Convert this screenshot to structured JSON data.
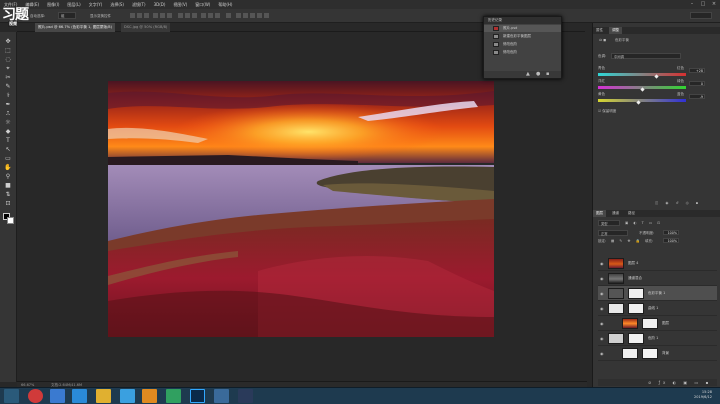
{
  "menubar": {
    "items": [
      "文件(F)",
      "编辑(E)",
      "图像(I)",
      "图层(L)",
      "文字(Y)",
      "选择(S)",
      "滤镜(T)",
      "3D(D)",
      "视图(V)",
      "窗口(W)",
      "帮助(H)"
    ]
  },
  "window_controls": {
    "min": "–",
    "max": "□",
    "close": "×"
  },
  "options_bar": {
    "auto_select_label": "自动选择:",
    "auto_select_value": "组",
    "transform_label": "显示变换控件"
  },
  "logo": {
    "big": "习题",
    "small": "视频"
  },
  "watermark": "8136628",
  "tabs": [
    {
      "label": "照片.psd @ 66.7% (色彩平衡 1, 图层蒙版/8)",
      "active": true
    },
    {
      "label": "DSC.jpg @ 50% (RGB/8)",
      "active": false
    }
  ],
  "tools": [
    "✥",
    "⬚",
    "◌",
    "⌖",
    "✂",
    "✎",
    "⚕",
    "✒",
    "⎍",
    "☼",
    "◆",
    "T",
    "↖",
    "▭",
    "✋",
    "⚲",
    "■",
    "⇅",
    "⊡"
  ],
  "history_panel": {
    "title": "历史记录",
    "items": [
      {
        "label": "照片.psd",
        "selected": true
      },
      {
        "label": "新建色彩平衡图层",
        "selected": false
      },
      {
        "label": "修改色阶",
        "selected": false
      },
      {
        "label": "修改色阶",
        "selected": false
      }
    ]
  },
  "properties_panel": {
    "tabs": [
      "属性",
      "调整"
    ],
    "title": "色彩平衡",
    "tone_label": "色调:",
    "tone_value": "中间调",
    "sliders": [
      {
        "left": "青色",
        "right": "红色",
        "value": "+28",
        "position": 0.66
      },
      {
        "left": "洋红",
        "right": "绿色",
        "value": "0",
        "position": 0.5
      },
      {
        "left": "黄色",
        "right": "蓝色",
        "value": "-9",
        "position": 0.45
      }
    ],
    "preserve_label": "保留明度"
  },
  "layers_panel": {
    "tabs": [
      "图层",
      "通道",
      "路径"
    ],
    "kind_label": "类型",
    "blend_mode": "正常",
    "opacity_label": "不透明度:",
    "opacity_value": "100%",
    "lock_label": "锁定:",
    "fill_label": "填充:",
    "fill_value": "100%",
    "layers": [
      {
        "name": "图层 4",
        "selected": false
      },
      {
        "name": "通道混合",
        "selected": false
      },
      {
        "name": "色彩平衡 1",
        "selected": true
      },
      {
        "name": "曲线 1",
        "selected": false
      },
      {
        "name": "图层",
        "selected": false
      },
      {
        "name": "色阶 1",
        "selected": false
      },
      {
        "name": "背景",
        "selected": false
      }
    ]
  },
  "status_bar": {
    "zoom": "66.67%",
    "doc": "文档:2.64M/41.6M"
  },
  "taskbar": {
    "time": "15:28",
    "date": "2019/6/12"
  },
  "colors": {
    "accent": "#31a8ff",
    "panel_bg": "#353535",
    "app_bg": "#282828",
    "taskbar": "#1e3a4f"
  }
}
